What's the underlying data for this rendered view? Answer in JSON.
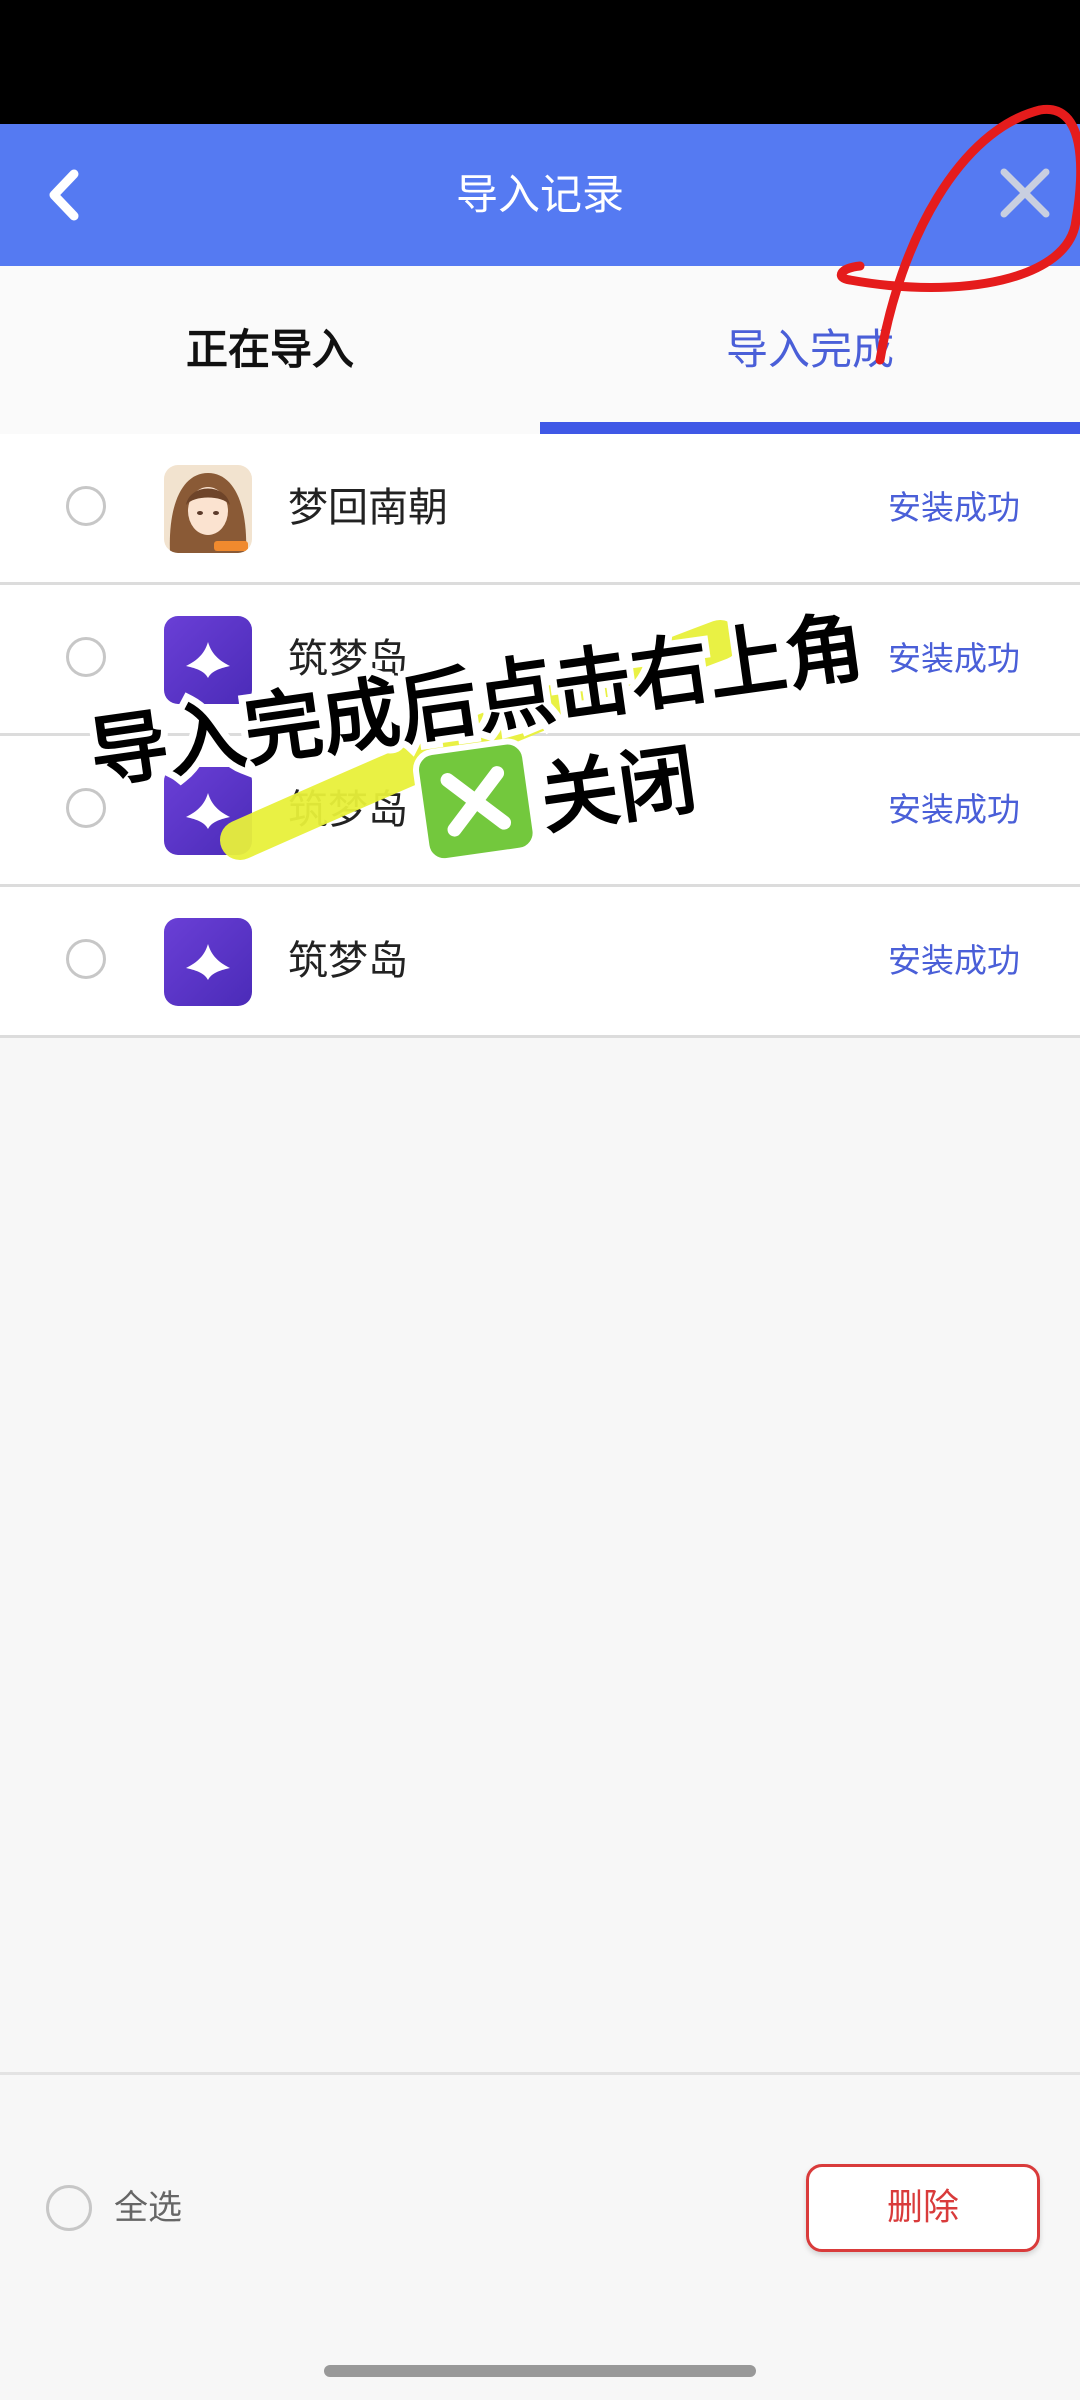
{
  "header": {
    "title": "导入记录",
    "back_icon": "chevron-left-icon",
    "close_icon": "close-icon",
    "background": "#557af2"
  },
  "tabs": [
    {
      "label": "正在导入",
      "active": false
    },
    {
      "label": "导入完成",
      "active": true
    }
  ],
  "list": {
    "items": [
      {
        "name": "梦回南朝",
        "status": "安装成功",
        "icon": "game-character-avatar-icon"
      },
      {
        "name": "筑梦岛",
        "status": "安装成功",
        "icon": "zhumengdao-app-icon"
      },
      {
        "name": "筑梦岛",
        "status": "安装成功",
        "icon": "zhumengdao-app-icon"
      },
      {
        "name": "筑梦岛",
        "status": "安装成功",
        "icon": "zhumengdao-app-icon"
      }
    ]
  },
  "footer": {
    "select_all_label": "全选",
    "delete_label": "删除"
  },
  "annotation": {
    "line1": "导入完成后点击右上角",
    "line2": "关闭",
    "highlight_color": "#e8f03a",
    "circle_color": "#e51c1c",
    "emoji_icon": "cross-mark-button-icon"
  },
  "colors": {
    "accent": "#3f58e6",
    "status_text": "#4a5fd8",
    "delete_red": "#d93b3b"
  }
}
